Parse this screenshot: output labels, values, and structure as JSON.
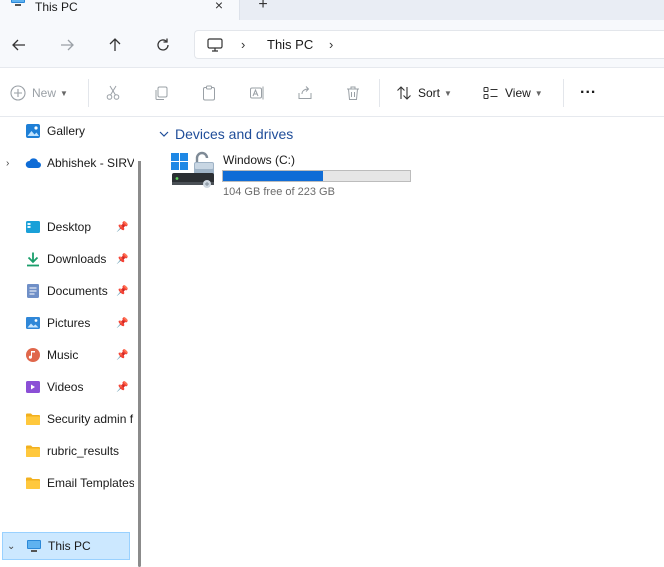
{
  "window": {
    "tab_title": "This PC",
    "tab_close": "×",
    "new_tab": "+"
  },
  "address": {
    "segment": "This PC",
    "separator": "›"
  },
  "commands": {
    "new_label": "New",
    "sort_label": "Sort",
    "view_label": "View",
    "more_label": "..."
  },
  "sidebar": {
    "items": [
      {
        "label": "Gallery",
        "icon": "gallery-icon"
      },
      {
        "label": "Abhishek - SIRV",
        "icon": "onedrive-cloud-icon"
      },
      {
        "label": "Desktop",
        "icon": "desktop-icon"
      },
      {
        "label": "Downloads",
        "icon": "downloads-icon"
      },
      {
        "label": "Documents",
        "icon": "documents-icon"
      },
      {
        "label": "Pictures",
        "icon": "pictures-icon"
      },
      {
        "label": "Music",
        "icon": "music-icon"
      },
      {
        "label": "Videos",
        "icon": "videos-icon"
      },
      {
        "label": "Security admin f",
        "icon": "folder-icon"
      },
      {
        "label": "rubric_results",
        "icon": "folder-icon"
      },
      {
        "label": "Email Templates",
        "icon": "folder-icon"
      },
      {
        "label": "This PC",
        "icon": "this-pc-icon"
      }
    ]
  },
  "content": {
    "group_title": "Devices and drives",
    "drives": [
      {
        "name": "Windows (C:)",
        "free_text": "104 GB free of 223 GB",
        "used_fraction": 0.534
      }
    ]
  },
  "colors": {
    "accent": "#0f6cd6",
    "selection_bg": "#cce8ff",
    "group_header": "#1f4d99"
  }
}
